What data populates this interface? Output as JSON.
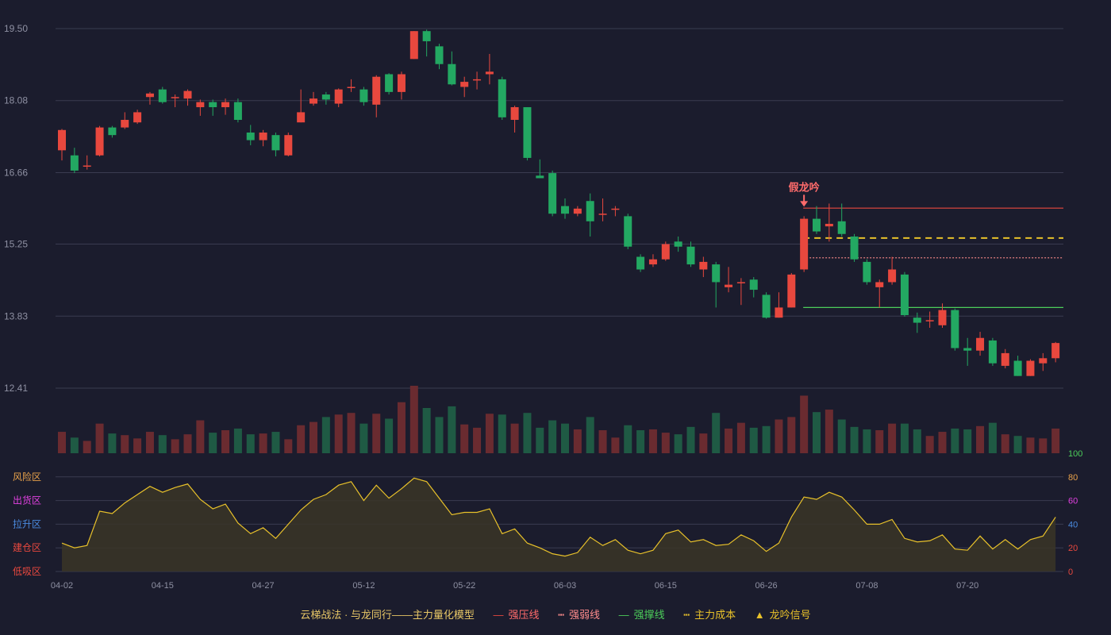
{
  "colors": {
    "background": "#1b1c2d",
    "up": "#e8483e",
    "down": "#23a862",
    "up_volume": "#6a2b30",
    "down_volume": "#1f5a44",
    "grid": "#3a3b50",
    "axis_text": "#8f91a3",
    "strong_pressure": "#e8483e",
    "weak_pressure": "#ff8c8c",
    "support": "#4ccd5a",
    "main_cost": "#e8c12a",
    "osc_line": "#e8c12a",
    "osc_fill": "#3a3527"
  },
  "legend": {
    "title": "云梯战法 · 与龙同行——主力量化模型",
    "strong_pressure": "强压线",
    "weak_pressure": "强弱线",
    "support": "强撑线",
    "main_cost": "主力成本",
    "signal": "龙吟信号"
  },
  "chart_data": [
    {
      "type": "candlestick",
      "price_ticks": [
        "19.50",
        "18.08",
        "16.66",
        "15.25",
        "13.83",
        "12.41"
      ],
      "ylim": [
        12.41,
        19.5
      ],
      "x_ticks": [
        "04-02",
        "04-15",
        "04-27",
        "05-12",
        "05-22",
        "06-03",
        "06-15",
        "06-26",
        "07-08",
        "07-20"
      ],
      "candles": [
        [
          17.1,
          17.5,
          17.52,
          16.9
        ],
        [
          17.0,
          16.7,
          17.15,
          16.65
        ],
        [
          16.8,
          16.8,
          17.0,
          16.72
        ],
        [
          17.0,
          17.55,
          17.58,
          16.98
        ],
        [
          17.55,
          17.4,
          17.58,
          17.35
        ],
        [
          17.55,
          17.7,
          17.85,
          17.52
        ],
        [
          17.65,
          17.85,
          17.9,
          17.62
        ],
        [
          18.15,
          18.22,
          18.25,
          18.0
        ],
        [
          18.3,
          18.05,
          18.35,
          18.02
        ],
        [
          18.15,
          18.15,
          18.2,
          17.95
        ],
        [
          18.12,
          18.27,
          18.3,
          17.98
        ],
        [
          17.95,
          18.05,
          18.1,
          17.78
        ],
        [
          18.05,
          17.95,
          18.1,
          17.78
        ],
        [
          17.95,
          18.05,
          18.12,
          17.8
        ],
        [
          18.05,
          17.7,
          18.12,
          17.65
        ],
        [
          17.45,
          17.3,
          17.6,
          17.2
        ],
        [
          17.3,
          17.45,
          17.5,
          17.18
        ],
        [
          17.4,
          17.1,
          17.45,
          16.98
        ],
        [
          17.0,
          17.4,
          17.45,
          16.98
        ],
        [
          17.65,
          17.85,
          18.3,
          17.65
        ],
        [
          18.02,
          18.12,
          18.25,
          17.98
        ],
        [
          18.2,
          18.1,
          18.25,
          18.0
        ],
        [
          18.02,
          18.3,
          18.32,
          17.95
        ],
        [
          18.35,
          18.35,
          18.5,
          18.25
        ],
        [
          18.3,
          18.05,
          18.35,
          17.98
        ],
        [
          18.0,
          18.55,
          18.58,
          17.75
        ],
        [
          18.6,
          18.25,
          18.62,
          18.2
        ],
        [
          18.25,
          18.6,
          18.65,
          18.1
        ],
        [
          18.9,
          19.45,
          19.45,
          18.9
        ],
        [
          19.45,
          19.25,
          19.48,
          18.95
        ],
        [
          19.15,
          18.8,
          19.2,
          18.7
        ],
        [
          18.8,
          18.4,
          19.05,
          18.38
        ],
        [
          18.35,
          18.45,
          18.55,
          18.15
        ],
        [
          18.5,
          18.5,
          18.65,
          18.3
        ],
        [
          18.6,
          18.65,
          19.0,
          18.4
        ],
        [
          18.5,
          17.75,
          18.55,
          17.7
        ],
        [
          17.7,
          17.95,
          17.98,
          17.45
        ],
        [
          17.95,
          16.95,
          17.95,
          16.9
        ],
        [
          16.6,
          16.55,
          16.92,
          16.55
        ],
        [
          16.65,
          15.85,
          16.7,
          15.8
        ],
        [
          16.0,
          15.85,
          16.15,
          15.75
        ],
        [
          15.85,
          15.95,
          16.0,
          15.8
        ],
        [
          16.1,
          15.7,
          16.25,
          15.4
        ],
        [
          15.85,
          15.85,
          16.15,
          15.7
        ],
        [
          15.95,
          15.95,
          16.0,
          15.8
        ],
        [
          15.8,
          15.2,
          15.85,
          15.15
        ],
        [
          15.0,
          14.75,
          15.05,
          14.7
        ],
        [
          14.85,
          14.95,
          15.05,
          14.8
        ],
        [
          14.95,
          15.25,
          15.3,
          14.92
        ],
        [
          15.3,
          15.2,
          15.4,
          15.1
        ],
        [
          15.2,
          14.85,
          15.3,
          14.8
        ],
        [
          14.75,
          14.9,
          15.0,
          14.6
        ],
        [
          14.85,
          14.5,
          14.9,
          14.0
        ],
        [
          14.4,
          14.45,
          14.8,
          14.3
        ],
        [
          14.5,
          14.5,
          14.58,
          14.05
        ],
        [
          14.55,
          14.35,
          14.6,
          14.2
        ],
        [
          14.25,
          13.8,
          14.3,
          13.78
        ],
        [
          13.8,
          14.0,
          14.3,
          13.8
        ],
        [
          14.0,
          14.65,
          14.68,
          14.0
        ],
        [
          14.75,
          15.75,
          15.8,
          14.7
        ],
        [
          15.75,
          15.5,
          16.0,
          15.45
        ],
        [
          15.6,
          15.65,
          16.05,
          15.3
        ],
        [
          15.7,
          15.45,
          16.05,
          15.4
        ],
        [
          15.4,
          14.95,
          15.45,
          14.9
        ],
        [
          14.9,
          14.5,
          14.95,
          14.45
        ],
        [
          14.4,
          14.5,
          14.55,
          14.0
        ],
        [
          14.5,
          14.75,
          15.0,
          14.45
        ],
        [
          14.65,
          13.85,
          14.7,
          13.82
        ],
        [
          13.8,
          13.7,
          13.9,
          13.5
        ],
        [
          13.75,
          13.75,
          13.92,
          13.6
        ],
        [
          13.65,
          13.95,
          14.08,
          13.6
        ],
        [
          13.95,
          13.2,
          13.98,
          13.15
        ],
        [
          13.2,
          13.15,
          13.4,
          12.85
        ],
        [
          13.15,
          13.4,
          13.52,
          13.05
        ],
        [
          13.35,
          12.9,
          13.4,
          12.85
        ],
        [
          12.85,
          13.1,
          13.18,
          12.8
        ],
        [
          12.95,
          12.65,
          13.05,
          12.65
        ],
        [
          12.65,
          12.95,
          12.98,
          12.65
        ],
        [
          12.9,
          13.0,
          13.1,
          12.75
        ],
        [
          13.0,
          13.3,
          13.32,
          12.92
        ]
      ],
      "volumes": [
        26,
        19,
        15,
        36,
        24,
        22,
        18,
        26,
        22,
        17,
        23,
        40,
        25,
        28,
        30,
        23,
        24,
        26,
        17,
        34,
        38,
        44,
        47,
        49,
        36,
        48,
        42,
        62,
        82,
        55,
        44,
        57,
        35,
        31,
        48,
        47,
        36,
        49,
        31,
        40,
        36,
        29,
        44,
        28,
        19,
        34,
        28,
        29,
        25,
        23,
        32,
        24,
        49,
        30,
        37,
        31,
        33,
        41,
        44,
        70,
        50,
        53,
        41,
        32,
        29,
        28,
        36,
        36,
        29,
        21,
        26,
        30,
        29,
        33,
        37,
        23,
        21,
        19,
        18,
        30
      ],
      "lines": {
        "strong_pressure": 15.96,
        "weak_pressure": 14.98,
        "support": 14.0,
        "main_cost": 15.37,
        "start_index": 59
      },
      "signal": {
        "index": 59,
        "label": "假龙吟"
      }
    },
    {
      "type": "area",
      "zones": [
        "风险区",
        "出货区",
        "拉升区",
        "建仓区",
        "低吸区"
      ],
      "zone_colors": [
        "#e8a24a",
        "#e040e0",
        "#4a8be0",
        "#e8483e",
        "#e8483e"
      ],
      "right_ticks": [
        "100",
        "80",
        "60",
        "40",
        "20",
        "0"
      ],
      "right_tick_colors": [
        "#4ccd5a",
        "#e8a24a",
        "#e040e0",
        "#4a8be0",
        "#e8483e",
        "#e8483e"
      ],
      "ylim": [
        0,
        100
      ],
      "values": [
        24,
        20,
        22,
        51,
        49,
        58,
        65,
        72,
        67,
        71,
        74,
        61,
        53,
        57,
        41,
        32,
        37,
        28,
        40,
        52,
        61,
        65,
        73,
        76,
        60,
        73,
        62,
        70,
        79,
        76,
        62,
        48,
        50,
        50,
        53,
        32,
        36,
        24,
        20,
        15,
        13,
        16,
        29,
        22,
        27,
        18,
        15,
        18,
        32,
        35,
        25,
        27,
        22,
        23,
        31,
        26,
        17,
        24,
        46,
        63,
        61,
        67,
        63,
        52,
        40,
        40,
        44,
        28,
        25,
        26,
        31,
        19,
        18,
        30,
        19,
        27,
        19,
        27,
        30,
        46
      ]
    }
  ]
}
